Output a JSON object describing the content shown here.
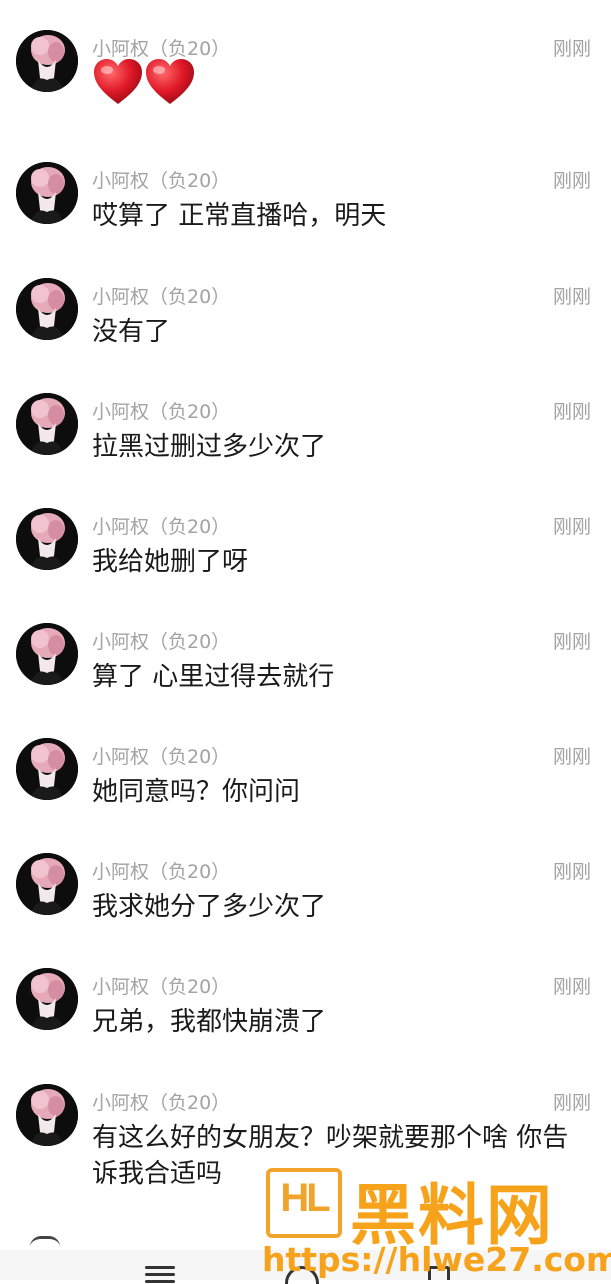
{
  "messages": [
    {
      "username": "小阿权（负20）",
      "time": "刚刚",
      "text": "",
      "hearts": 2
    },
    {
      "username": "小阿权（负20）",
      "time": "刚刚",
      "text": "哎算了 正常直播哈，明天"
    },
    {
      "username": "小阿权（负20）",
      "time": "刚刚",
      "text": "没有了"
    },
    {
      "username": "小阿权（负20）",
      "time": "刚刚",
      "text": "拉黑过删过多少次了"
    },
    {
      "username": "小阿权（负20）",
      "time": "刚刚",
      "text": "我给她删了呀"
    },
    {
      "username": "小阿权（负20）",
      "time": "刚刚",
      "text": "算了 心里过得去就行"
    },
    {
      "username": "小阿权（负20）",
      "time": "刚刚",
      "text": "她同意吗？你问问"
    },
    {
      "username": "小阿权（负20）",
      "time": "刚刚",
      "text": "我求她分了多少次了"
    },
    {
      "username": "小阿权（负20）",
      "time": "刚刚",
      "text": "兄弟，我都快崩溃了"
    },
    {
      "username": "小阿权（负20）",
      "time": "刚刚",
      "text": "有这么好的女朋友？吵架就要那个啥 你告诉我合适吗"
    }
  ],
  "watermark": {
    "title": "黑料网",
    "url": "https://hlwe27.com",
    "logo_text": "HL",
    "color": "#f7a21b"
  },
  "colors": {
    "meta_text": "#a3a3a3",
    "body_text": "#1a1a1a",
    "heart": "#e01828"
  },
  "icons": [
    "avatar-icon",
    "heart-icon",
    "menu-icon",
    "home-icon",
    "back-icon"
  ]
}
